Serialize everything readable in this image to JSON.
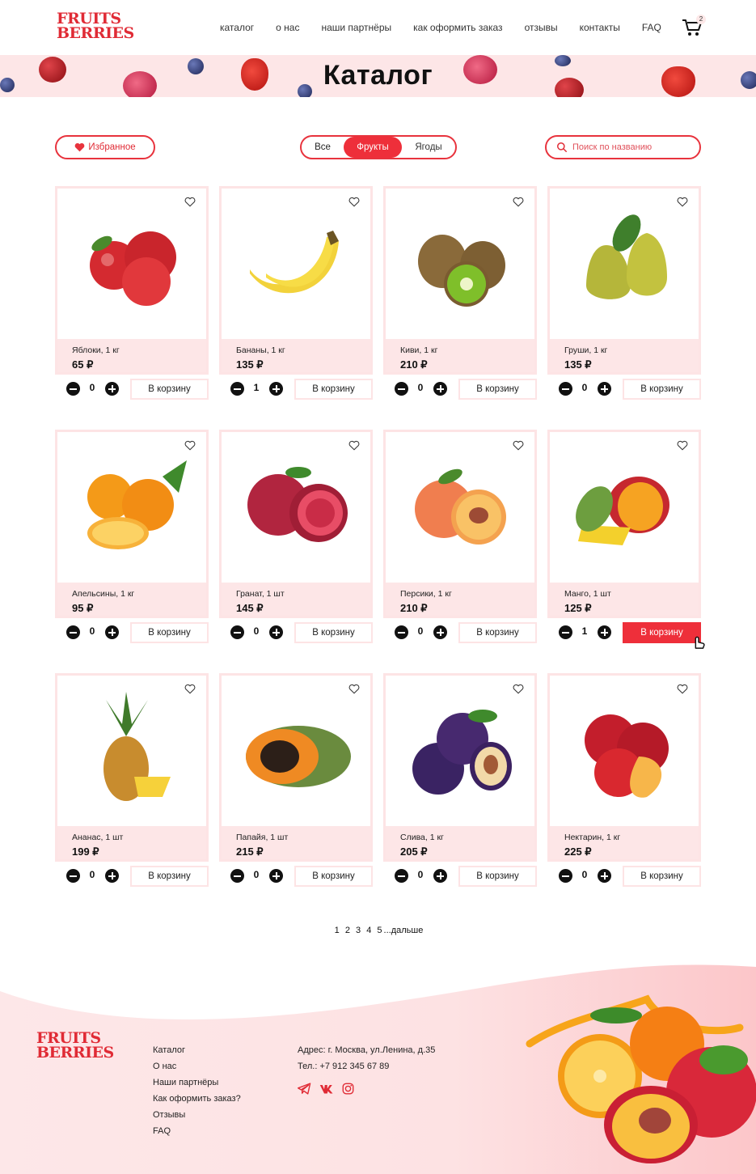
{
  "brand": {
    "line1": "FRUITS",
    "line2": "BERRIES",
    "color": "#e02b35"
  },
  "nav": [
    "каталог",
    "о нас",
    "наши партнёры",
    "как оформить заказ",
    "отзывы",
    "контакты",
    "FAQ"
  ],
  "cart": {
    "count": "2"
  },
  "banner": {
    "title": "Каталог"
  },
  "filters": {
    "favorites_label": "Избранное",
    "segments": [
      "Все",
      "Фрукты",
      "Ягоды"
    ],
    "active_segment": "Фрукты",
    "search_placeholder": "Поиск по названию"
  },
  "products": [
    {
      "name": "Яблоки, 1 кг",
      "price": "65 ₽",
      "qty": "0",
      "button": "В корзину",
      "icon": "apple"
    },
    {
      "name": "Бананы, 1 кг",
      "price": "135 ₽",
      "qty": "1",
      "button": "В корзину",
      "icon": "banana"
    },
    {
      "name": "Киви, 1 кг",
      "price": "210 ₽",
      "qty": "0",
      "button": "В корзину",
      "icon": "kiwi"
    },
    {
      "name": "Груши, 1 кг",
      "price": "135 ₽",
      "qty": "0",
      "button": "В корзину",
      "icon": "pear"
    },
    {
      "name": "Апельсины, 1 кг",
      "price": "95 ₽",
      "qty": "0",
      "button": "В корзину",
      "icon": "orange"
    },
    {
      "name": "Гранат, 1 шт",
      "price": "145 ₽",
      "qty": "0",
      "button": "В корзину",
      "icon": "pomegranate"
    },
    {
      "name": "Персики, 1 кг",
      "price": "210 ₽",
      "qty": "0",
      "button": "В корзину",
      "icon": "peach"
    },
    {
      "name": "Манго, 1 шт",
      "price": "125 ₽",
      "qty": "1",
      "button": "В корзину",
      "icon": "mango",
      "active": true
    },
    {
      "name": "Ананас, 1 шт",
      "price": "199 ₽",
      "qty": "0",
      "button": "В корзину",
      "icon": "pineapple"
    },
    {
      "name": "Папайя, 1 шт",
      "price": "215 ₽",
      "qty": "0",
      "button": "В корзину",
      "icon": "papaya"
    },
    {
      "name": "Слива, 1 кг",
      "price": "205 ₽",
      "qty": "0",
      "button": "В корзину",
      "icon": "plum"
    },
    {
      "name": "Нектарин, 1 кг",
      "price": "225 ₽",
      "qty": "0",
      "button": "В корзину",
      "icon": "nectarine"
    }
  ],
  "pagination": {
    "pages": [
      "1",
      "2",
      "3",
      "4",
      "5"
    ],
    "ellipsis": "...",
    "next": "дальше"
  },
  "footer": {
    "links": [
      "Каталог",
      "О нас",
      "Наши партнёры",
      "Как оформить заказ?",
      "Отзывы",
      "FAQ"
    ],
    "address": "Адрес: г. Москва, ул.Ленина, д.35",
    "phone": "Тел.: +7 912 345 67 89",
    "social_icons": [
      "telegram-icon",
      "vk-icon",
      "instagram-icon"
    ]
  },
  "colors": {
    "accent": "#ee2f3a",
    "pink_bg": "#fde6e7",
    "card_border": "#fde4e5"
  }
}
